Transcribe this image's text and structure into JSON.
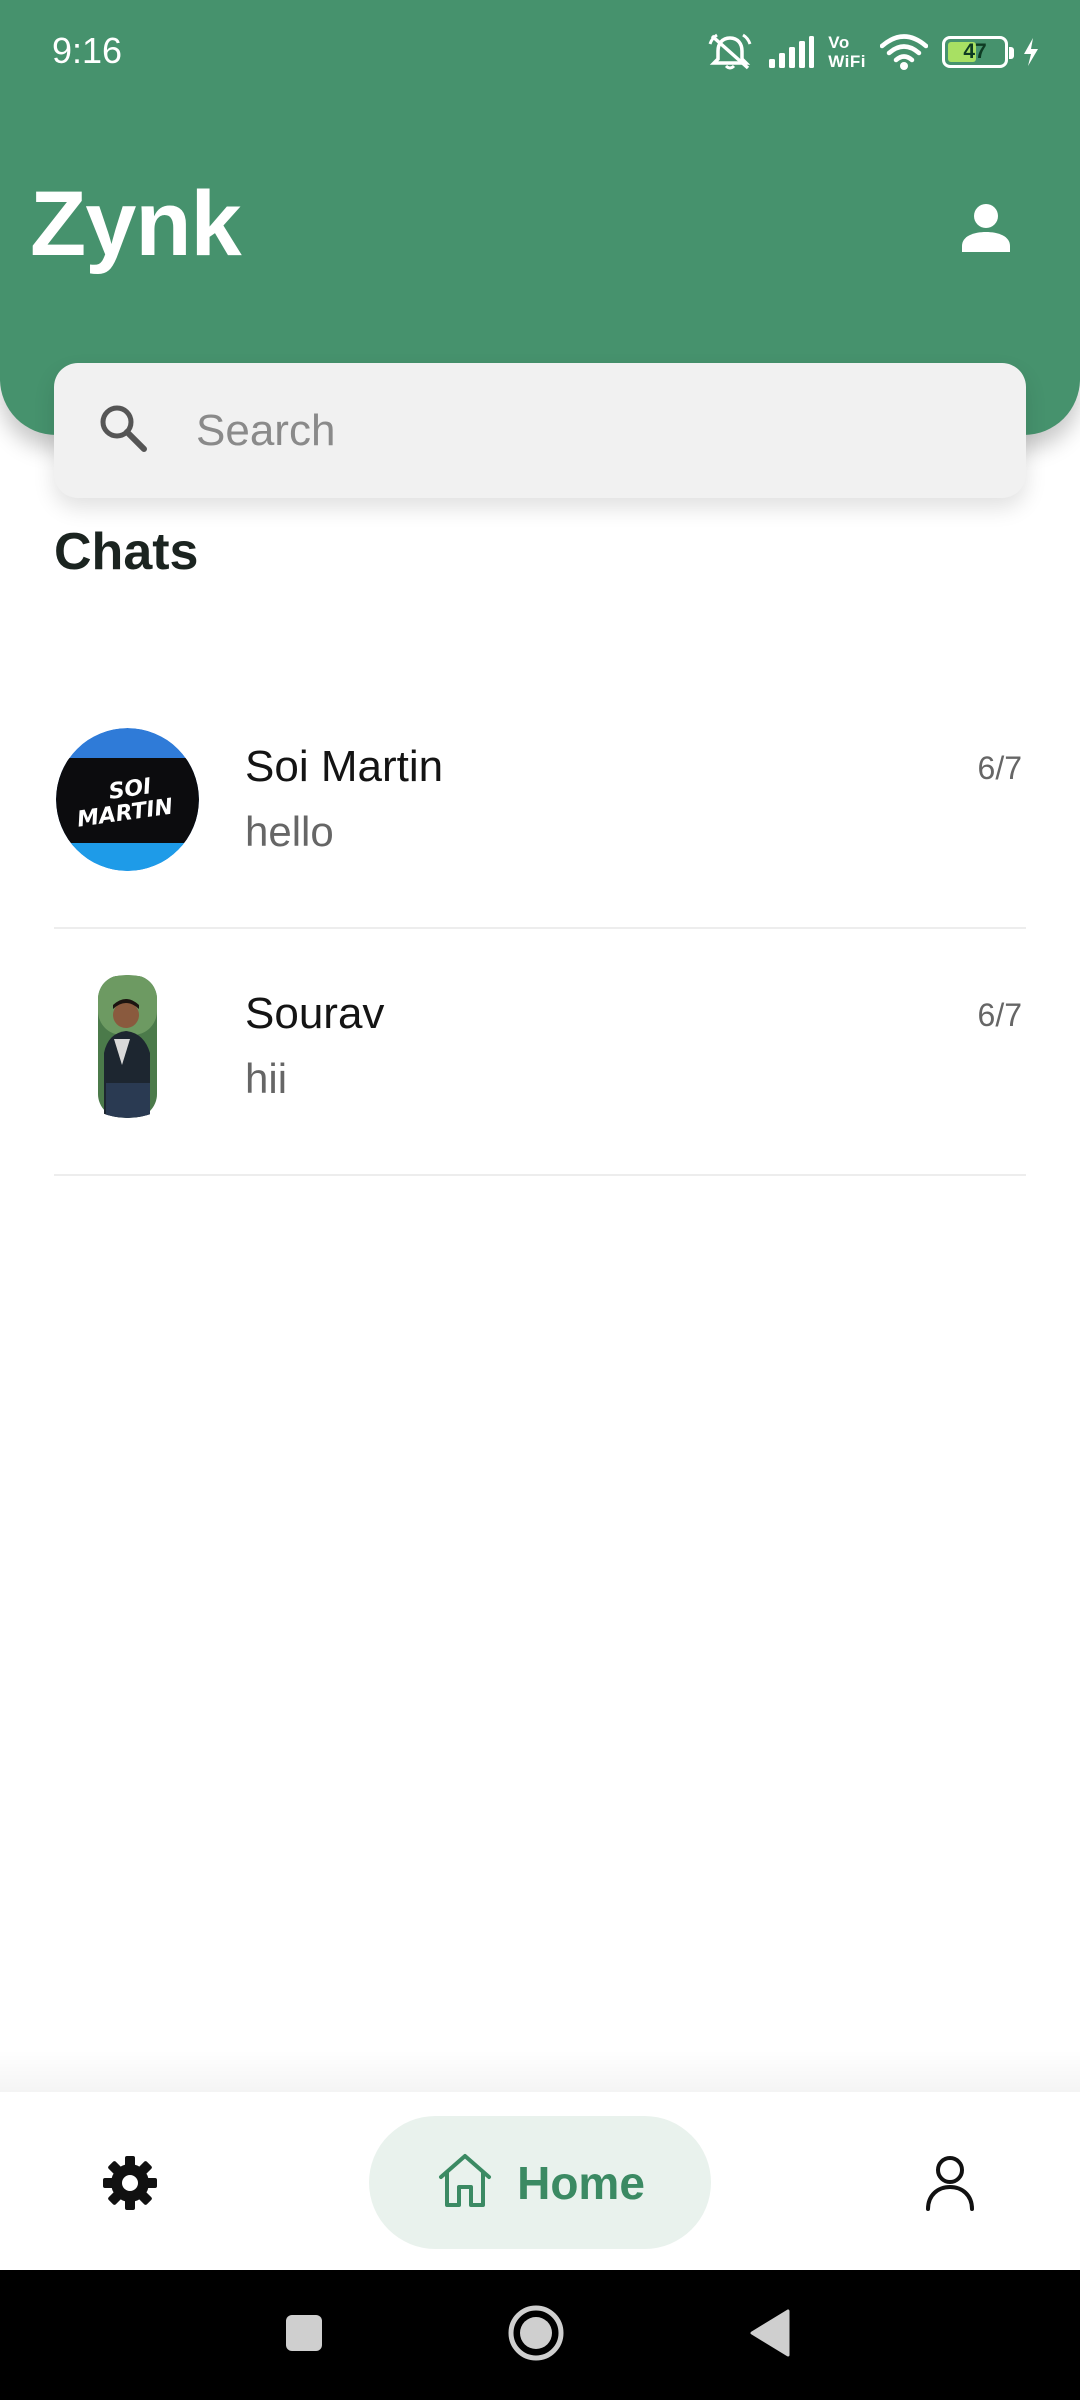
{
  "status_bar": {
    "time": "9:16",
    "vowifi_top": "Vo",
    "vowifi_bottom": "WiFi",
    "battery_percent": "47",
    "icons": [
      "mute-alarm-icon",
      "signal-icon",
      "vowifi-icon",
      "wifi-icon",
      "battery-icon",
      "charging-icon"
    ]
  },
  "header": {
    "title": "Zynk",
    "profile_icon": "person-icon",
    "background_color": "#46926d"
  },
  "search": {
    "placeholder": "Search",
    "value": "",
    "icon": "search-icon"
  },
  "section": {
    "title": "Chats"
  },
  "chats": [
    {
      "name": "Soi Martin",
      "preview": "hello",
      "time": "6/7",
      "avatar_text_top": "SOI",
      "avatar_text_bottom": "MARTIN"
    },
    {
      "name": "Sourav",
      "preview": "hii",
      "time": "6/7"
    }
  ],
  "bottom_nav": {
    "items": [
      {
        "icon": "gear-icon",
        "label": ""
      },
      {
        "icon": "home-icon",
        "label": "Home",
        "active": true
      },
      {
        "icon": "user-outline-icon",
        "label": ""
      }
    ],
    "accent_color": "#3b8a63",
    "active_background": "#e9f2ed"
  },
  "system_nav": {
    "buttons": [
      "recents-icon",
      "home-circle-icon",
      "back-icon"
    ]
  }
}
